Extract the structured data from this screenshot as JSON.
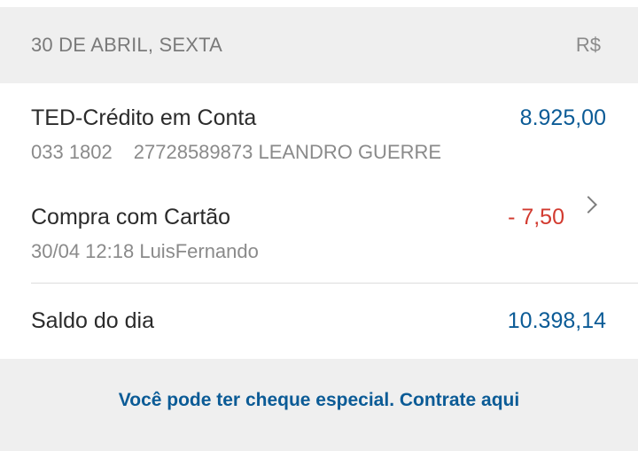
{
  "header": {
    "date": "30 DE ABRIL, SEXTA",
    "currency": "R$"
  },
  "transactions": [
    {
      "title": "TED-Crédito em Conta",
      "details": [
        "033 1802",
        "27728589873 LEANDRO GUERRE"
      ],
      "amount": "8.925,00",
      "type": "credit"
    },
    {
      "title": "Compra com Cartão",
      "details": [
        "30/04 12:18 LuisFernando"
      ],
      "amount": "- 7,50",
      "type": "debit"
    }
  ],
  "balance": {
    "label": "Saldo do dia",
    "value": "10.398,14"
  },
  "footer": {
    "link_text": "Você pode ter cheque especial. Contrate aqui"
  },
  "colors": {
    "credit": "#0b5b96",
    "debit": "#d23a2f",
    "link": "#0b5b96",
    "band_bg": "#efefef"
  },
  "icons": {
    "detail_chevron": "chevron-right-icon"
  }
}
